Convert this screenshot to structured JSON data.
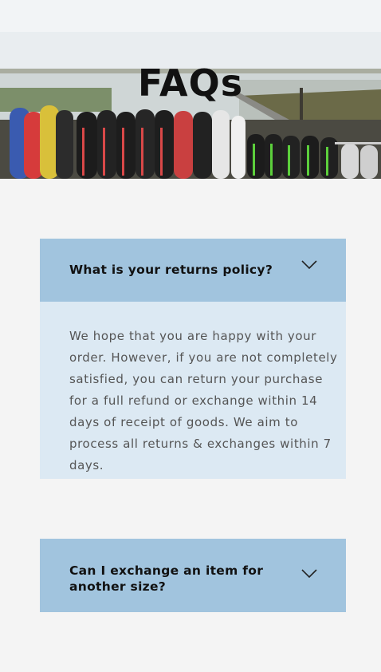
{
  "hero": {
    "title": "FAQs"
  },
  "faq": {
    "items": [
      {
        "question": "What is your returns policy?",
        "answer": "We hope that you are happy with your order. However, if you are not completely satisfied, you can return your purchase for a full refund or exchange within 14 days of receipt of goods. We aim to process all returns & exchanges within 7 days.",
        "expanded": true,
        "icon": "chevron-down-icon"
      },
      {
        "question": "Can I exchange an item for another size?",
        "expanded": false,
        "icon": "chevron-down-icon"
      }
    ]
  },
  "colors": {
    "question_bg": "#a1c4de",
    "answer_bg": "#dce9f3",
    "page_bg": "#f4f4f4"
  }
}
